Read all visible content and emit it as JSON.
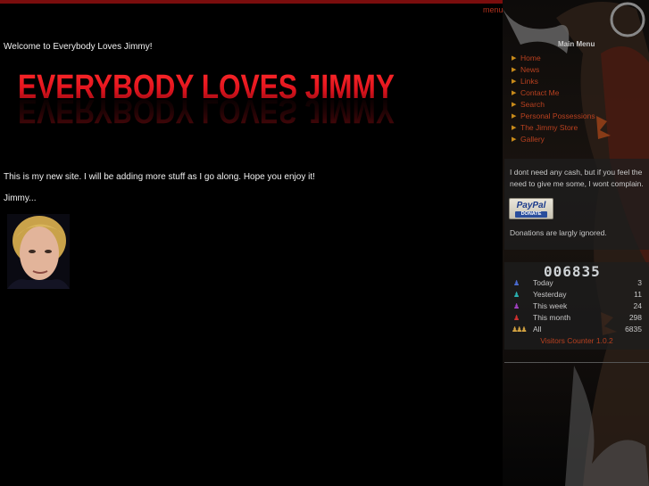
{
  "top": {
    "menu_link": "menu"
  },
  "main": {
    "welcome": "Welcome to Everybody Loves Jimmy!",
    "banner_text": "EVERYBODY LOVES JIMMY",
    "intro": "This is my new site.  I will be adding more stuff as I go along.  Hope you enjoy it!",
    "signature": "Jimmy..."
  },
  "sidebar": {
    "menu_title": "Main Menu",
    "menu_items": [
      {
        "label": "Home"
      },
      {
        "label": "News"
      },
      {
        "label": "Links"
      },
      {
        "label": "Contact Me"
      },
      {
        "label": "Search"
      },
      {
        "label": "Personal Possessions"
      },
      {
        "label": "The Jimmy Store"
      },
      {
        "label": "Gallery"
      }
    ],
    "donate_text": "I dont need any cash, but if you feel the need to give me some, I wont complain.",
    "paypal_label": "PayPal",
    "paypal_donate": "DONATE",
    "donate_note": "Donations are largly ignored.",
    "counter": {
      "digits": "006835",
      "rows": [
        {
          "label": "Today",
          "value": "3"
        },
        {
          "label": "Yesterday",
          "value": "11"
        },
        {
          "label": "This week",
          "value": "24"
        },
        {
          "label": "This month",
          "value": "298"
        },
        {
          "label": "All",
          "value": "6835"
        }
      ],
      "credit": "Visitors Counter 1.0.2"
    }
  },
  "colors": {
    "link": "#b8401f",
    "accent": "#7a0d0d",
    "banner_red": "#e0141e"
  }
}
